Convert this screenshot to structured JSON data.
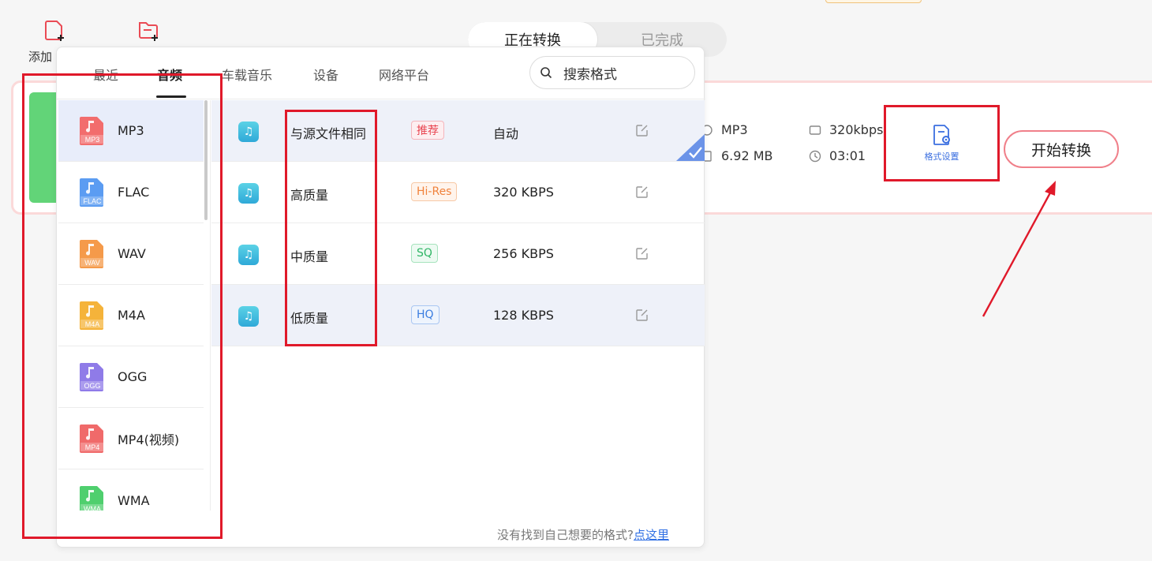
{
  "toolbar": {
    "add_label": "添加",
    "add_file_icon": "file-plus-icon",
    "add_folder_icon": "folder-plus-icon"
  },
  "conversion_tabs": [
    "正在转换",
    "已完成"
  ],
  "file_card": {
    "format": "MP3",
    "bitrate": "320kbps",
    "size": "6.92 MB",
    "duration": "03:01",
    "format_settings_label": "格式设置",
    "start_button_label": "开始转换"
  },
  "popup": {
    "category_tabs": [
      "最近",
      "音频",
      "车载音乐",
      "设备",
      "网络平台"
    ],
    "active_tab": "音频",
    "search_placeholder": "搜索格式",
    "formats": [
      {
        "name": "MP3",
        "tag": "MP3",
        "color": "#f26d6d"
      },
      {
        "name": "FLAC",
        "tag": "FLAC",
        "color": "#5b9cf2"
      },
      {
        "name": "WAV",
        "tag": "WAV",
        "color": "#f59a4a"
      },
      {
        "name": "M4A",
        "tag": "M4A",
        "color": "#f5b33a"
      },
      {
        "name": "OGG",
        "tag": "OGG",
        "color": "#8f7be8"
      },
      {
        "name": "MP4(视频)",
        "tag": "MP4",
        "color": "#f06a6a"
      },
      {
        "name": "WMA",
        "tag": "WMA",
        "color": "#4fcf6e"
      }
    ],
    "selected_format": "MP3",
    "qualities": [
      {
        "name": "与源文件相同",
        "badge": "推荐",
        "rate": "自动"
      },
      {
        "name": "高质量",
        "badge": "Hi-Res",
        "rate": "320 KBPS"
      },
      {
        "name": "中质量",
        "badge": "SQ",
        "rate": "256 KBPS"
      },
      {
        "name": "低质量",
        "badge": "HQ",
        "rate": "128 KBPS"
      }
    ],
    "footer_text": "没有找到自己想要的格式?",
    "footer_link": "点这里"
  },
  "colors": {
    "accent_red": "#e0192a",
    "badge_recommend": "#e8434f",
    "badge_hires": "#f0823c",
    "badge_sq": "#2fb565",
    "badge_hq": "#3b7de0",
    "link_blue": "#2f6fe4"
  }
}
